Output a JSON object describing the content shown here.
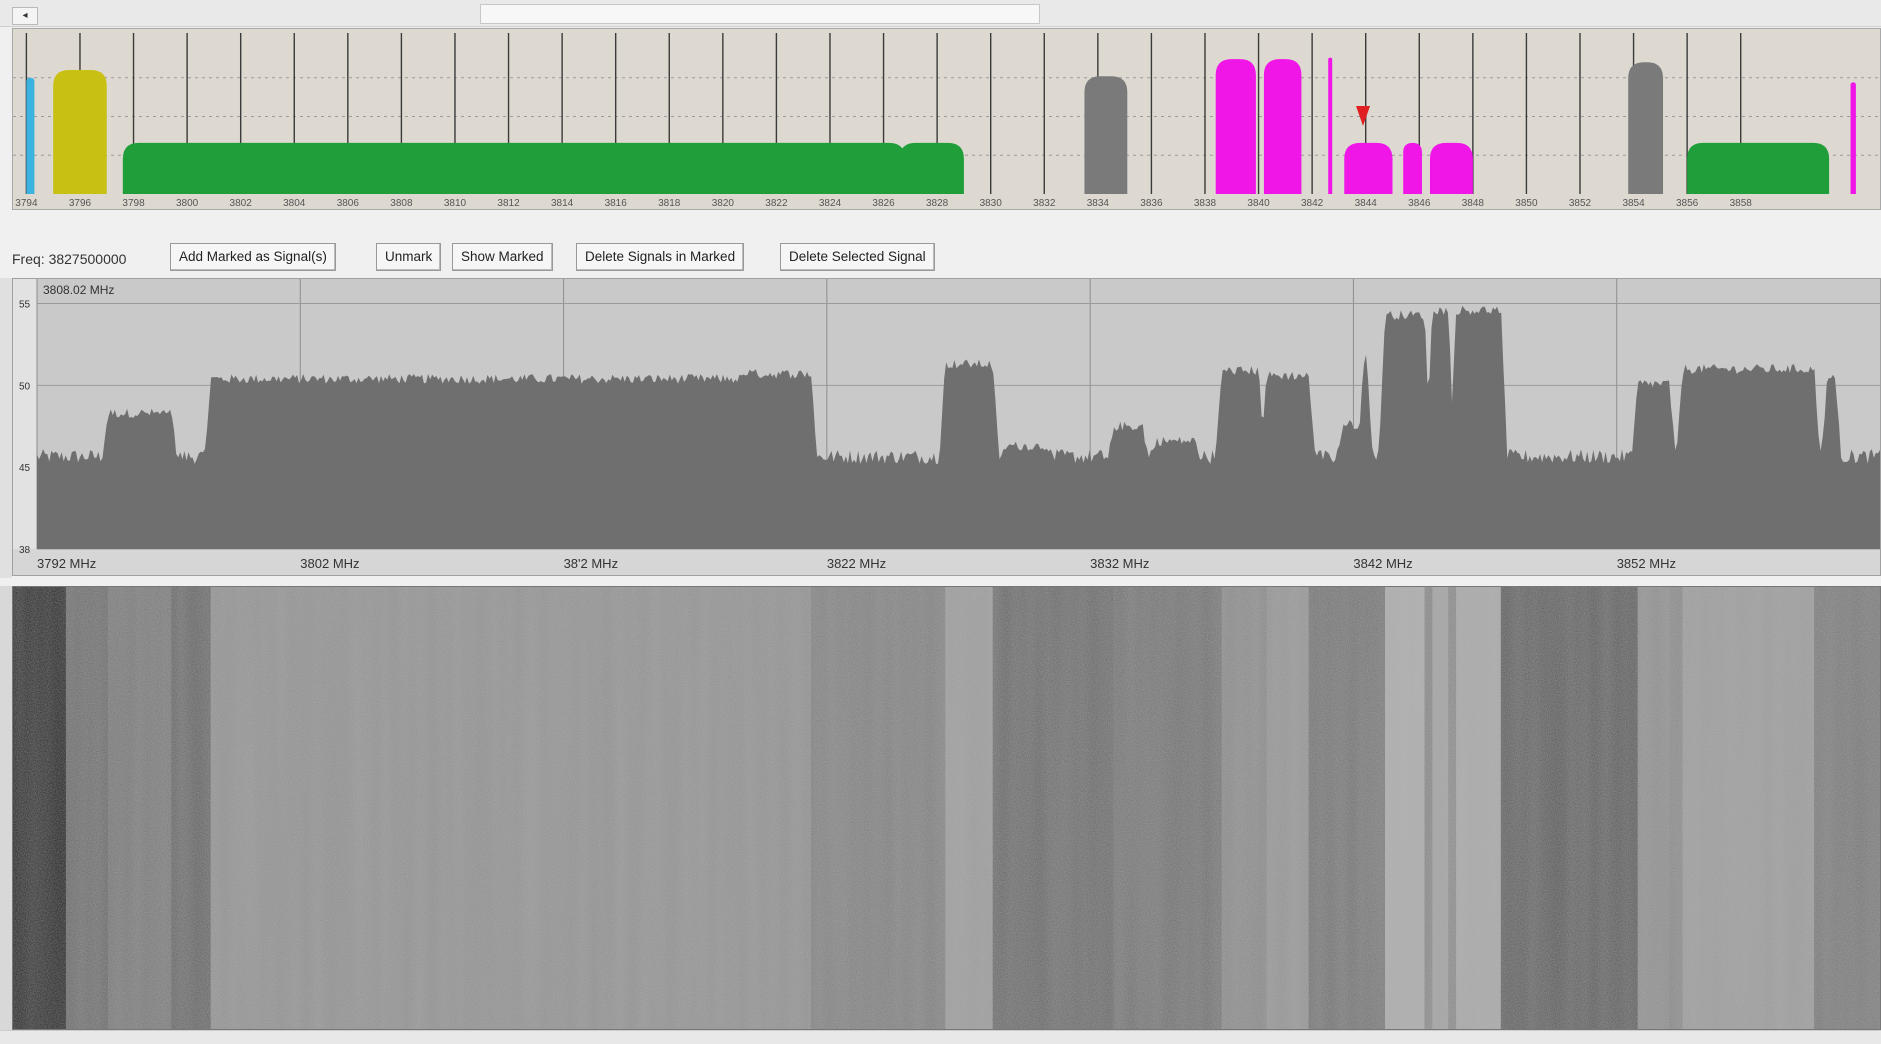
{
  "window": {
    "scroll_left_glyph": "◂"
  },
  "signal_map": {
    "tick_labels": [
      "3794",
      "3796",
      "3798",
      "3800",
      "3802",
      "3804",
      "3806",
      "3808",
      "3810",
      "3812",
      "3814",
      "3816",
      "3818",
      "3820",
      "3822",
      "3824",
      "3826",
      "3828",
      "3830",
      "3832",
      "3834",
      "3836",
      "3838",
      "3840",
      "3842",
      "3844",
      "3846",
      "3848",
      "3850",
      "3852",
      "3854",
      "3856",
      "3858"
    ],
    "signals": [
      {
        "f_start": 3794.0,
        "f_end": 3794.3,
        "level": 0.75,
        "color": "#3ab3e0"
      },
      {
        "f_start": 3795.0,
        "f_end": 3797.0,
        "level": 0.8,
        "color": "#c8c012"
      },
      {
        "f_start": 3797.6,
        "f_end": 3826.8,
        "level": 0.33,
        "color": "#1f9e3a"
      },
      {
        "f_start": 3826.6,
        "f_end": 3829.0,
        "level": 0.33,
        "color": "#1f9e3a"
      },
      {
        "f_start": 3833.5,
        "f_end": 3835.1,
        "level": 0.76,
        "color": "#7a7a7a"
      },
      {
        "f_start": 3838.4,
        "f_end": 3839.9,
        "level": 0.87,
        "color": "#f016e8"
      },
      {
        "f_start": 3840.2,
        "f_end": 3841.6,
        "level": 0.87,
        "color": "#f016e8"
      },
      {
        "f_start": 3842.6,
        "f_end": 3842.75,
        "level": 0.88,
        "color": "#f016e8"
      },
      {
        "f_start": 3843.2,
        "f_end": 3845.0,
        "level": 0.33,
        "color": "#f016e8"
      },
      {
        "f_start": 3845.4,
        "f_end": 3846.1,
        "level": 0.33,
        "color": "#f016e8"
      },
      {
        "f_start": 3846.4,
        "f_end": 3848.0,
        "level": 0.33,
        "color": "#f016e8"
      },
      {
        "f_start": 3853.8,
        "f_end": 3855.1,
        "level": 0.85,
        "color": "#7a7a7a"
      },
      {
        "f_start": 3856.0,
        "f_end": 3861.3,
        "level": 0.33,
        "color": "#1f9e3a"
      },
      {
        "f_start": 3862.1,
        "f_end": 3862.3,
        "level": 0.72,
        "color": "#f016e8"
      }
    ],
    "marker_freq": 3843.9,
    "marker_color": "#e02020"
  },
  "toolbar": {
    "freq_text": "Freq: 3827500000",
    "buttons": [
      "Add Marked as Signal(s)",
      "Unmark",
      "Show Marked",
      "Delete Signals in Marked",
      "Delete Selected Signal"
    ]
  },
  "spectrum": {
    "cursor_readout": "3808.02 MHz",
    "x_tick_labels": [
      "3792 MHz",
      "3802 MHz",
      "38'2 MHz",
      "3822 MHz",
      "3832 MHz",
      "3842 MHz",
      "3852 MHz"
    ],
    "x_ticks": [
      3792,
      3802,
      3812,
      3822,
      3832,
      3842,
      3852
    ],
    "y_tick_labels": [
      "55",
      "50",
      "45",
      "38"
    ],
    "y_ticks": [
      55,
      50,
      45,
      40
    ],
    "x_range": [
      3792,
      3862
    ],
    "y_range": [
      40,
      56.5
    ],
    "noise_floor": 45.2,
    "fill_color": "#6f6f6f",
    "bg_color": "#c9c9c9",
    "bands": [
      {
        "f_start": 3794.7,
        "f_end": 3797.1,
        "level": 48.3
      },
      {
        "f_start": 3798.6,
        "f_end": 3818.9,
        "level": 50.4
      },
      {
        "f_start": 3818.9,
        "f_end": 3821.4,
        "level": 50.7
      },
      {
        "f_start": 3826.5,
        "f_end": 3828.3,
        "level": 51.3
      },
      {
        "f_start": 3828.8,
        "f_end": 3830.4,
        "level": 46.3
      },
      {
        "f_start": 3832.9,
        "f_end": 3834.0,
        "level": 47.5
      },
      {
        "f_start": 3834.5,
        "f_end": 3836.0,
        "level": 46.6
      },
      {
        "f_start": 3837.0,
        "f_end": 3838.4,
        "level": 50.9
      },
      {
        "f_start": 3838.7,
        "f_end": 3840.3,
        "level": 50.6
      },
      {
        "f_start": 3841.6,
        "f_end": 3842.3,
        "level": 47.6
      },
      {
        "f_start": 3842.4,
        "f_end": 3842.5,
        "level": 51.6
      },
      {
        "f_start": 3843.2,
        "f_end": 3844.7,
        "level": 54.3
      },
      {
        "f_start": 3845.0,
        "f_end": 3845.6,
        "level": 54.6
      },
      {
        "f_start": 3845.9,
        "f_end": 3847.6,
        "level": 54.6
      },
      {
        "f_start": 3852.8,
        "f_end": 3854.0,
        "level": 50.1
      },
      {
        "f_start": 3854.5,
        "f_end": 3859.5,
        "level": 51.0
      },
      {
        "f_start": 3860.0,
        "f_end": 3860.3,
        "level": 50.4
      }
    ]
  },
  "waterfall": {
    "base_gray": 128,
    "columns": [
      {
        "f_start": 3792.0,
        "f_end": 3793.1,
        "gray": 20
      },
      {
        "f_start": 3793.1,
        "f_end": 3794.7,
        "gray": 95
      },
      {
        "f_start": 3794.7,
        "f_end": 3797.1,
        "gray": 110
      },
      {
        "f_start": 3797.1,
        "f_end": 3798.6,
        "gray": 88
      },
      {
        "f_start": 3798.6,
        "f_end": 3821.4,
        "gray": 138
      },
      {
        "f_start": 3821.4,
        "f_end": 3826.5,
        "gray": 118
      },
      {
        "f_start": 3826.5,
        "f_end": 3828.3,
        "gray": 150
      },
      {
        "f_start": 3828.3,
        "f_end": 3832.9,
        "gray": 92
      },
      {
        "f_start": 3832.9,
        "f_end": 3837.0,
        "gray": 102
      },
      {
        "f_start": 3837.0,
        "f_end": 3838.4,
        "gray": 130
      },
      {
        "f_start": 3838.7,
        "f_end": 3840.3,
        "gray": 142
      },
      {
        "f_start": 3840.3,
        "f_end": 3843.2,
        "gray": 104
      },
      {
        "f_start": 3843.2,
        "f_end": 3844.7,
        "gray": 170
      },
      {
        "f_start": 3845.0,
        "f_end": 3845.6,
        "gray": 158
      },
      {
        "f_start": 3845.9,
        "f_end": 3847.6,
        "gray": 165
      },
      {
        "f_start": 3847.6,
        "f_end": 3852.8,
        "gray": 80
      },
      {
        "f_start": 3852.8,
        "f_end": 3854.0,
        "gray": 135
      },
      {
        "f_start": 3854.5,
        "f_end": 3859.5,
        "gray": 150
      },
      {
        "f_start": 3859.5,
        "f_end": 3862.0,
        "gray": 110
      }
    ]
  }
}
